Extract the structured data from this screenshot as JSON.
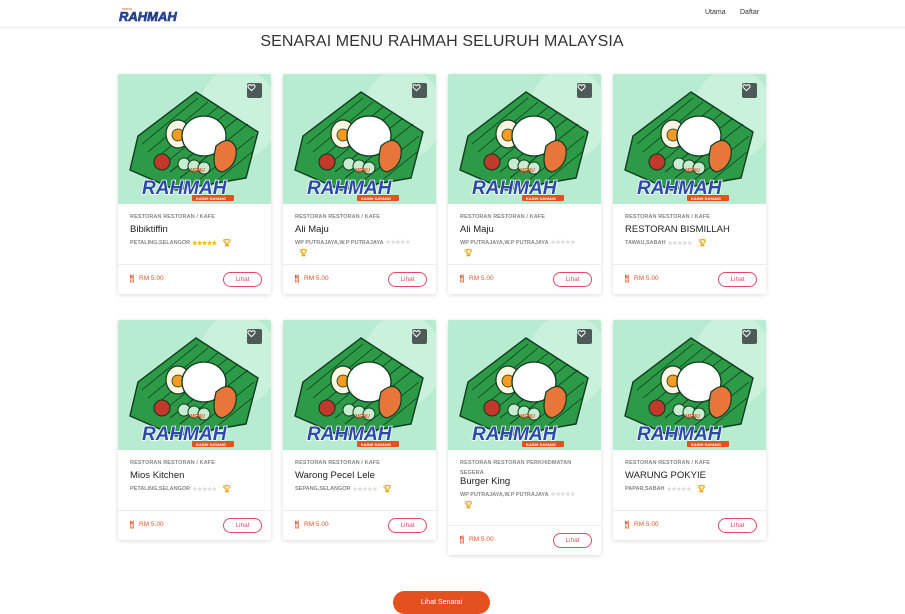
{
  "header": {
    "logo_text": "RAHMAH",
    "logo_small": "menu",
    "nav": [
      "Utama",
      "Daftar"
    ]
  },
  "title": "SENARAI MENU RAHMAH SELURUH MALAYSIA",
  "thumb_text": {
    "menu": "MENU",
    "rahmah": "RAHMAH",
    "tagline": "KASIH SAYANG"
  },
  "colors": {
    "accent": "#e5501f",
    "thumb_bg": "#b8ecd0",
    "leaf": "#1f8a3a",
    "outline_pink": "#e04a6a",
    "star": "#f4b400"
  },
  "cards": [
    {
      "category": "RESTORAN RESTORAN / KAFE",
      "name": "Bibiktiffin",
      "location": "PETALING,SELANGOR",
      "stars": "★★★★★",
      "stars_filled": true,
      "price": "RM 5.00",
      "button": "Lihat"
    },
    {
      "category": "RESTORAN RESTORAN / KAFE",
      "name": "Ali Maju",
      "location": "WP PUTRAJAYA,W.P PUTRAJAYA",
      "stars": "★★★★★",
      "stars_filled": false,
      "price": "RM 5.00",
      "button": "Lihat"
    },
    {
      "category": "RESTORAN RESTORAN / KAFE",
      "name": "Ali Maju",
      "location": "WP PUTRAJAYA,W.P PUTRAJAYA",
      "stars": "★★★★★",
      "stars_filled": false,
      "price": "RM 5.00",
      "button": "Lihat"
    },
    {
      "category": "RESTORAN RESTORAN / KAFE",
      "name": "RESTORAN BISMILLAH",
      "location": "TAWAU,SABAH",
      "stars": "★★★★★",
      "stars_filled": false,
      "price": "RM 5.00",
      "button": "Lihat"
    },
    {
      "category": "RESTORAN RESTORAN / KAFE",
      "name": "Mios Kitchen",
      "location": "PETALING,SELANGOR",
      "stars": "★★★★★",
      "stars_filled": false,
      "price": "RM 5.00",
      "button": "Lihat"
    },
    {
      "category": "RESTORAN RESTORAN / KAFE",
      "name": "Warong Pecel Lele",
      "location": "SEPANG,SELANGOR",
      "stars": "★★★★★",
      "stars_filled": false,
      "price": "RM 5.00",
      "button": "Lihat"
    },
    {
      "category": "RESTORAN RESTORAN PERKHIDMATAN SEGERA",
      "name": "Burger King",
      "location": "WP PUTRAJAYA,W.P PUTRAJAYA",
      "stars": "★★★★★",
      "stars_filled": false,
      "price": "RM 5.00",
      "button": "Lihat"
    },
    {
      "category": "RESTORAN RESTORAN / KAFE",
      "name": "WARUNG POKYIE",
      "location": "PAPAR,SABAH",
      "stars": "★★★★★",
      "stars_filled": false,
      "price": "RM 5.00",
      "button": "Lihat"
    }
  ],
  "footer": {
    "button": "Lihat Senarai"
  }
}
